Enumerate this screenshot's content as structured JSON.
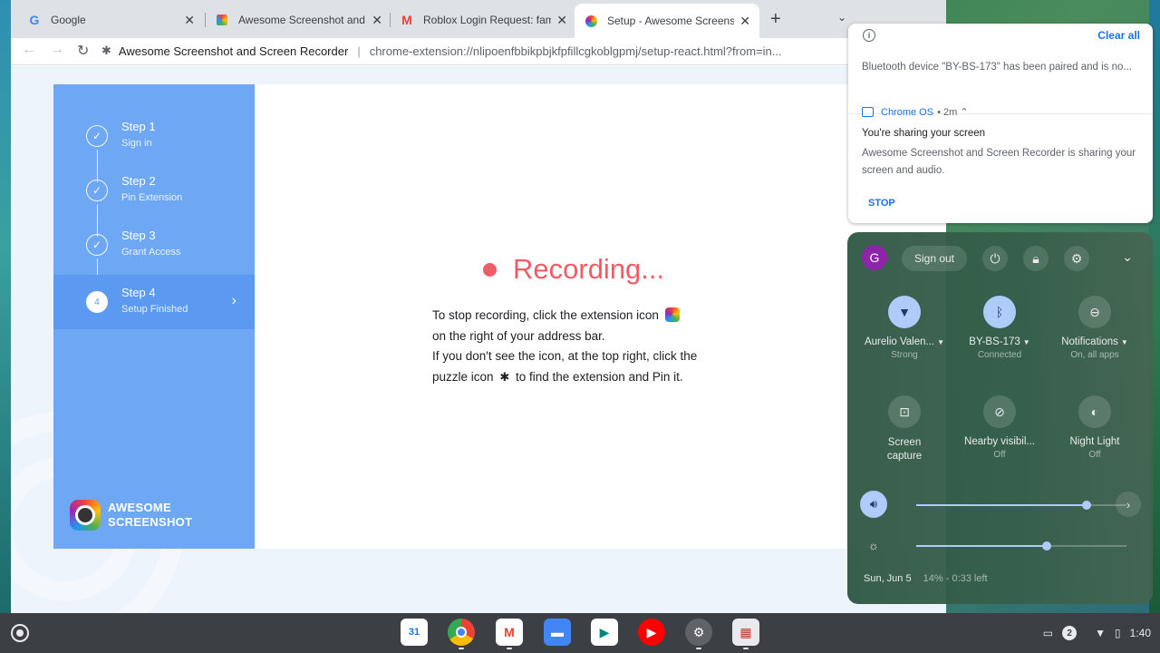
{
  "tabs": [
    {
      "title": "Google",
      "favicon": "google-icon"
    },
    {
      "title": "Awesome Screenshot and Screen Recorder",
      "favicon": "awesome-screenshot-icon"
    },
    {
      "title": "Roblox Login Request: family",
      "favicon": "gmail-icon"
    },
    {
      "title": "Setup - Awesome Screenshot",
      "favicon": "awesome-screenshot-icon"
    }
  ],
  "tab_close": "✕",
  "new_tab": "+",
  "omnibox": {
    "site": "Awesome Screenshot and Screen Recorder",
    "url": "chrome-extension://nlipoenfbbikpbjkfpfillcgkoblgpmj/setup-react.html?from=in..."
  },
  "steps": [
    {
      "title": "Step 1",
      "subtitle": "Sign in",
      "state": "done"
    },
    {
      "title": "Step 2",
      "subtitle": "Pin Extension",
      "state": "done"
    },
    {
      "title": "Step 3",
      "subtitle": "Grant Access",
      "state": "done"
    },
    {
      "title": "Step 4",
      "subtitle": "Setup Finished",
      "state": "active",
      "number": "4"
    }
  ],
  "brand": {
    "line1": "AWESOME",
    "line2": "SCREENSHOT"
  },
  "main": {
    "recording_title": "Recording...",
    "line1": "To stop recording, click the extension icon",
    "line2": "on the right of your address bar.",
    "line3": "If you don't see the icon, at the top right, click the",
    "line4a": "puzzle icon",
    "line4b": "to find the extension and Pin it."
  },
  "notifications": {
    "clear_all": "Clear all",
    "bluetooth_text": "Bluetooth device \"BY-BS-173\" has been paired and is no...",
    "screen_share": {
      "app": "Chrome OS",
      "time": "• 2m ⌃",
      "title": "You're sharing your screen",
      "body": "Awesome Screenshot and Screen Recorder is sharing your screen and audio.",
      "action": "STOP"
    }
  },
  "quick_settings": {
    "avatar_letter": "G",
    "sign_out": "Sign out",
    "tiles": [
      {
        "label": "Aurelio Valen...",
        "sub": "Strong",
        "icon": "wifi-icon",
        "on": true,
        "dropdown": true
      },
      {
        "label": "BY-BS-173",
        "sub": "Connected",
        "icon": "bluetooth-icon",
        "on": true,
        "dropdown": true
      },
      {
        "label": "Notifications",
        "sub": "On, all apps",
        "icon": "notifications-icon",
        "on": false,
        "dropdown": true
      },
      {
        "label": "Screen capture",
        "sub": "",
        "icon": "screen-capture-icon",
        "on": false,
        "dropdown": false
      },
      {
        "label": "Nearby visibil...",
        "sub": "Off",
        "icon": "nearby-visibility-icon",
        "on": false,
        "dropdown": false
      },
      {
        "label": "Night Light",
        "sub": "Off",
        "icon": "night-light-icon",
        "on": false,
        "dropdown": false
      }
    ],
    "volume_level": 0.81,
    "brightness_level": 0.62,
    "date": "Sun, Jun 5",
    "battery": "14% - 0:33 left"
  },
  "shelf": {
    "notification_count": "2",
    "time": "1:40",
    "apps": [
      "calendar-icon",
      "chrome-icon",
      "gmail-icon",
      "files-icon",
      "meet-icon",
      "youtube-icon",
      "settings-icon",
      "photos-icon"
    ]
  }
}
